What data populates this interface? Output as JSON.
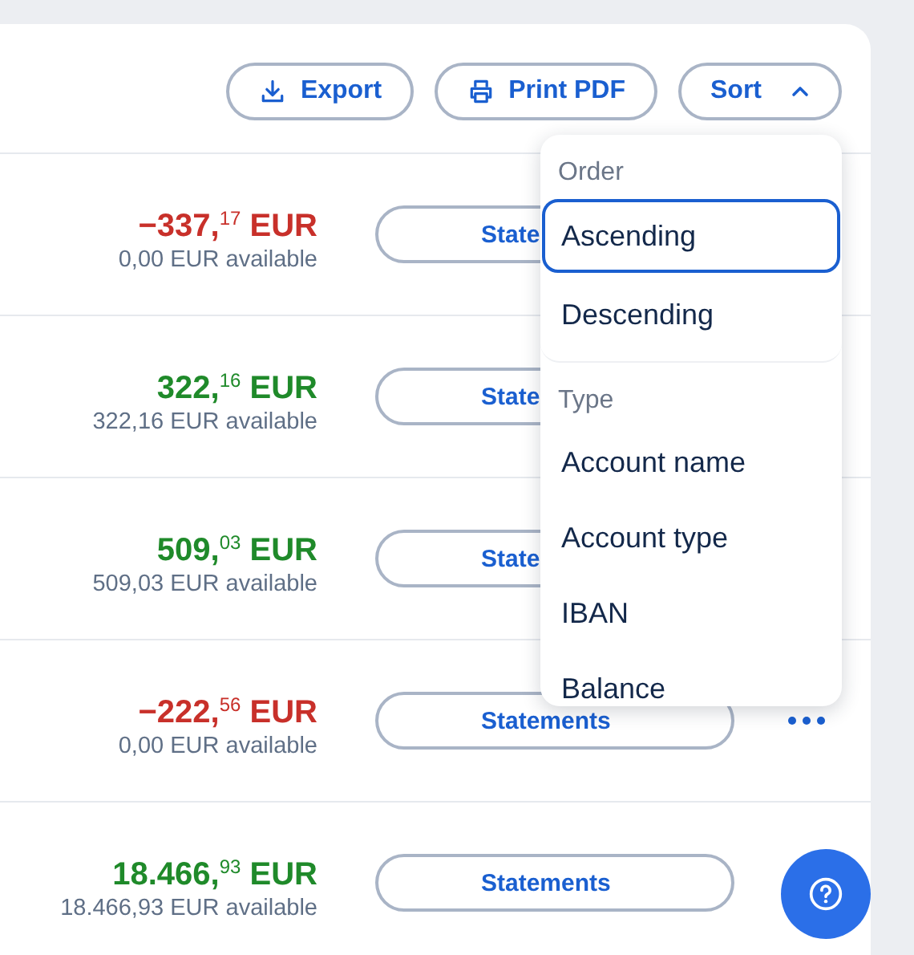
{
  "toolbar": [
    {
      "kind": "export",
      "label": "Export"
    },
    {
      "kind": "print",
      "label": "Print PDF"
    },
    {
      "kind": "sort",
      "label": "Sort",
      "expanded": true
    }
  ],
  "rows": [
    {
      "amount": "−337,$^{17}$ EUR",
      "negative": true,
      "available": "0,00 EUR available",
      "button": "State"
    },
    {
      "amount": "322,$^{16}$ EUR",
      "negative": false,
      "available": "322,16 EUR available",
      "button": "State"
    },
    {
      "amount": "509,$^{03}$ EUR",
      "negative": false,
      "available": "509,03 EUR available",
      "button": "State"
    },
    {
      "amount": "−222,$^{56}$ EUR",
      "negative": true,
      "available": "0,00 EUR available",
      "button": "Statements",
      "more_button": true
    },
    {
      "amount": "18.466,$^{93}$ EUR",
      "negative": false,
      "available": "18.466,93 EUR available",
      "button": "Statements"
    }
  ],
  "sort_menu": {
    "groups": [
      {
        "heading": "Order",
        "items": [
          {
            "label": "Ascending",
            "selected": true
          },
          {
            "label": "Descending",
            "selected": false
          }
        ]
      },
      {
        "heading": "Type",
        "items": [
          {
            "label": "Account name",
            "selected": false
          },
          {
            "label": "Account type",
            "selected": false
          },
          {
            "label": "IBAN",
            "selected": false
          },
          {
            "label": "Balance",
            "selected": false
          }
        ]
      }
    ]
  }
}
